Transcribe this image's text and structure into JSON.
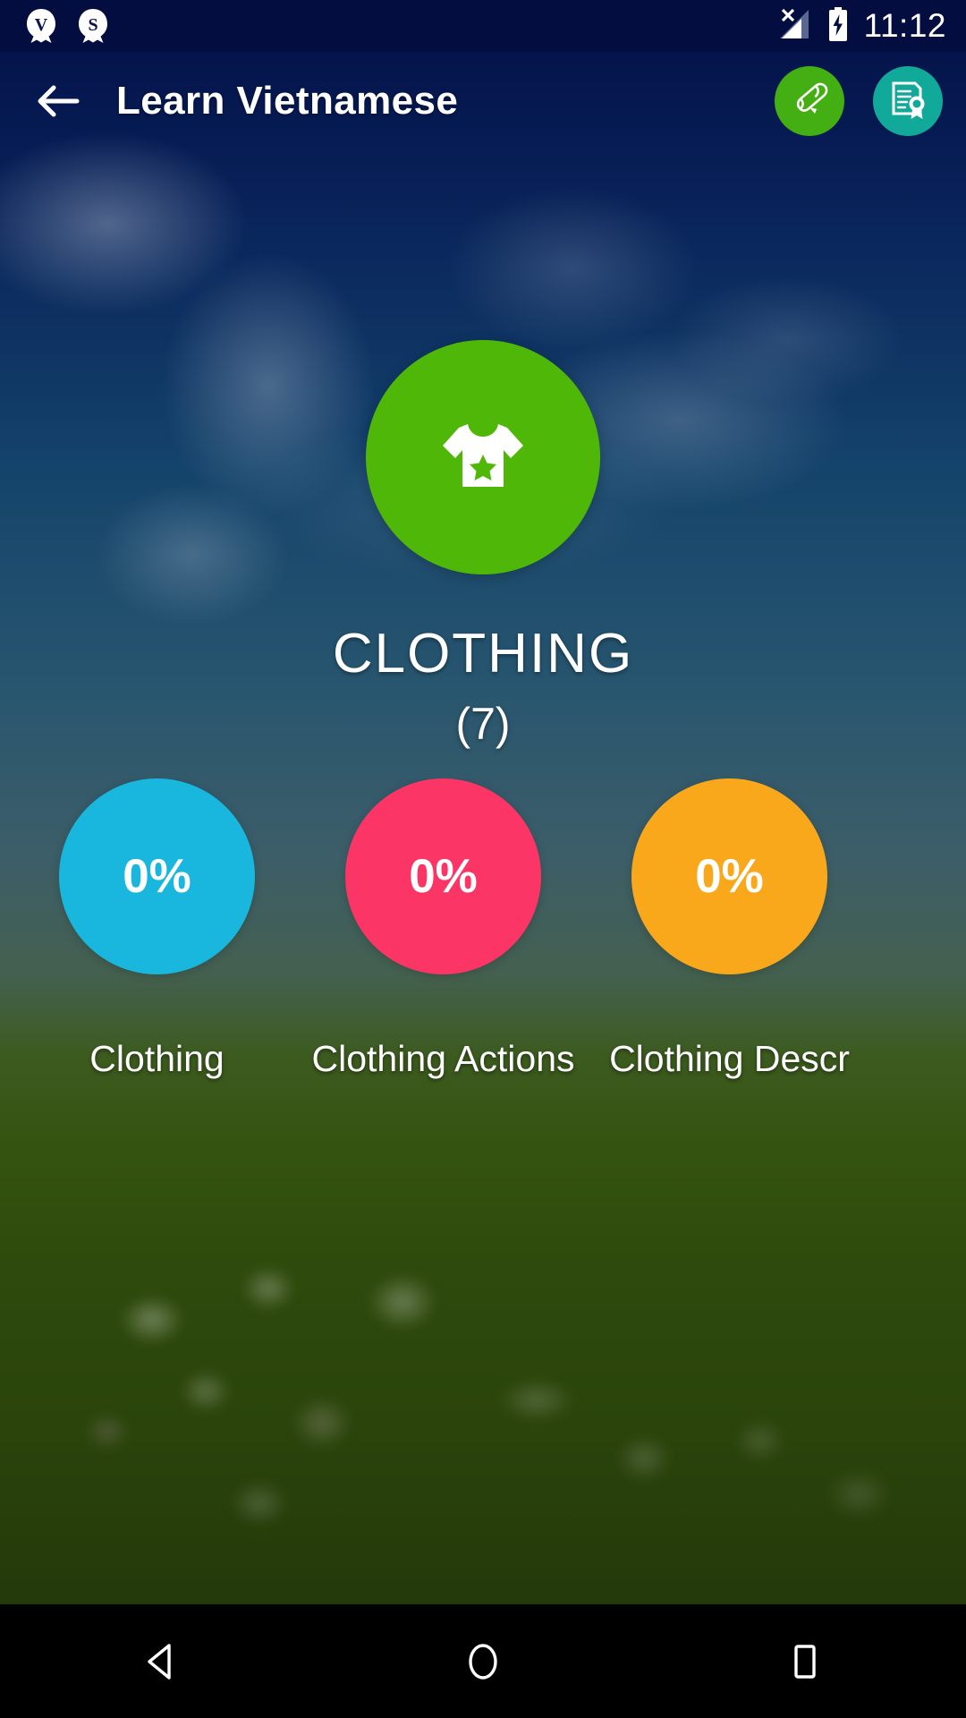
{
  "status_bar": {
    "notifications": [
      {
        "icon": "badge-v-icon",
        "letter": "V"
      },
      {
        "icon": "badge-s-icon",
        "letter": "S"
      }
    ],
    "signal_icon": "signal-no-service-icon",
    "battery_icon": "battery-charging-icon",
    "time": "11:12",
    "background_color": "#030d3f"
  },
  "app_bar": {
    "back_icon": "back-arrow-icon",
    "title": "Learn Vietnamese",
    "actions": [
      {
        "icon": "diploma-scroll-icon",
        "color": "#43af13",
        "name": "diploma-button"
      },
      {
        "icon": "certificate-icon",
        "color": "#11a99a",
        "name": "certificate-button"
      }
    ]
  },
  "category": {
    "icon": "tshirt-icon",
    "icon_circle_color": "#4fb707",
    "title": "CLOTHING",
    "count": "(7)"
  },
  "lessons": [
    {
      "label": "Clothing",
      "percent": "0%",
      "color": "#19b6dd"
    },
    {
      "label": "Clothing Actions",
      "percent": "0%",
      "color": "#fb3566"
    },
    {
      "label": "Clothing Descr",
      "percent": "0%",
      "color": "#f9a81c"
    }
  ],
  "nav_bar": {
    "back_icon": "nav-back-triangle-icon",
    "home_icon": "nav-home-circle-icon",
    "recents_icon": "nav-recents-square-icon",
    "background_color": "#000000"
  }
}
